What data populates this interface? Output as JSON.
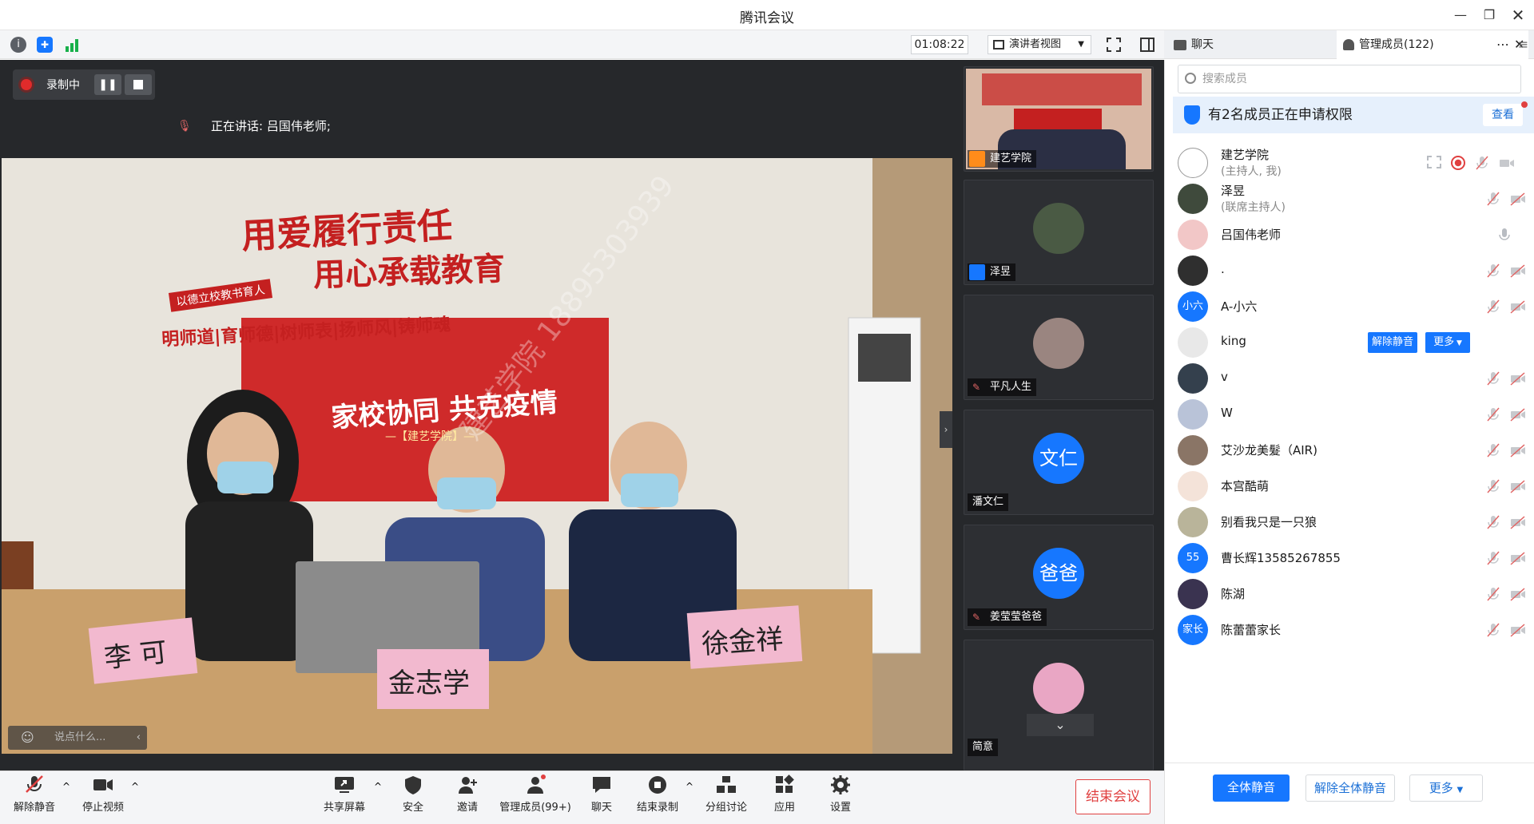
{
  "window": {
    "title": "腾讯会议"
  },
  "toolbar": {
    "timer": "01:08:22",
    "view_mode": "演讲者视图"
  },
  "tabs": {
    "chat": "聊天",
    "members": "管理成员(122)"
  },
  "stage": {
    "recording_label": "录制中",
    "speaking_label": "正在讲话: 吕国伟老师;",
    "chat_placeholder": "说点什么...",
    "video": {
      "banner_line1": "用爱履行责任",
      "banner_line2": "用心承载教育",
      "banner_sub": "以德立校教书育人",
      "banner_line3": "明师道|育师德|树师表|扬师风|铸师魂",
      "poster_title": "家校协同 共克疫情",
      "poster_sub": "—【建艺学院】—",
      "watermark": "建艺学院 18895303939",
      "nameplates": [
        "李 可",
        "金志学",
        "徐金祥"
      ]
    }
  },
  "thumbnails": [
    {
      "name": "建艺学院",
      "avatar_text": "",
      "color": "#888888"
    },
    {
      "name": "泽昱",
      "avatar_text": "",
      "color": "#4a5a44"
    },
    {
      "name": "平凡人生",
      "avatar_text": "",
      "color": "#9a8580"
    },
    {
      "name": "潘文仁",
      "avatar_text": "文仁",
      "color": "#1677ff"
    },
    {
      "name": "姜莹莹爸爸",
      "avatar_text": "爸爸",
      "color": "#1677ff"
    },
    {
      "name": "简意",
      "avatar_text": "",
      "color": "#e9a6c4"
    }
  ],
  "bottombar": {
    "unmute": "解除静音",
    "stop_video": "停止视频",
    "share": "共享屏幕",
    "security": "安全",
    "invite": "邀请",
    "manage_members": "管理成员(99+)",
    "chat": "聊天",
    "end_record": "结束录制",
    "breakout": "分组讨论",
    "apps": "应用",
    "settings": "设置",
    "end_meeting": "结束会议"
  },
  "panel": {
    "search_placeholder": "搜索成员",
    "notice": "有2名成员正在申请权限",
    "notice_view": "查看",
    "members": [
      {
        "name": "建艺学院",
        "sub": "(主持人, 我)",
        "avatar": "",
        "color": "#ffffff"
      },
      {
        "name": "泽昱",
        "sub": "(联席主持人)",
        "avatar": "",
        "color": "#3f4a3c"
      },
      {
        "name": "吕国伟老师",
        "sub": "",
        "avatar": "",
        "color": "#f2c7c7"
      },
      {
        "name": ".",
        "sub": "",
        "avatar": "",
        "color": "#2f2f2f"
      },
      {
        "name": "A-小六",
        "sub": "",
        "avatar": "小六",
        "color": "#1677ff"
      },
      {
        "name": "king",
        "sub": "",
        "avatar": "",
        "color": "#e8e8e8"
      },
      {
        "name": "v",
        "sub": "",
        "avatar": "",
        "color": "#34404d"
      },
      {
        "name": "W",
        "sub": "",
        "avatar": "",
        "color": "#b9c3d8"
      },
      {
        "name": "艾沙龙美髮（AIR)",
        "sub": "",
        "avatar": "",
        "color": "#8a7566"
      },
      {
        "name": "本宫酷萌",
        "sub": "",
        "avatar": "",
        "color": "#f4e3d9"
      },
      {
        "name": "别看我只是一只狼",
        "sub": "",
        "avatar": "",
        "color": "#b9b49a"
      },
      {
        "name": "曹长辉13585267855",
        "sub": "",
        "avatar": "55",
        "color": "#1677ff"
      },
      {
        "name": "陈湖",
        "sub": "",
        "avatar": "",
        "color": "#3a3350"
      },
      {
        "name": "陈蕾蕾家长",
        "sub": "",
        "avatar": "家长",
        "color": "#1677ff"
      }
    ],
    "king_unmute": "解除静音",
    "king_more": "更多",
    "mute_all": "全体静音",
    "unmute_all": "解除全体静音",
    "more": "更多"
  },
  "colors": {
    "accent": "#1677ff",
    "danger": "#e04040"
  }
}
